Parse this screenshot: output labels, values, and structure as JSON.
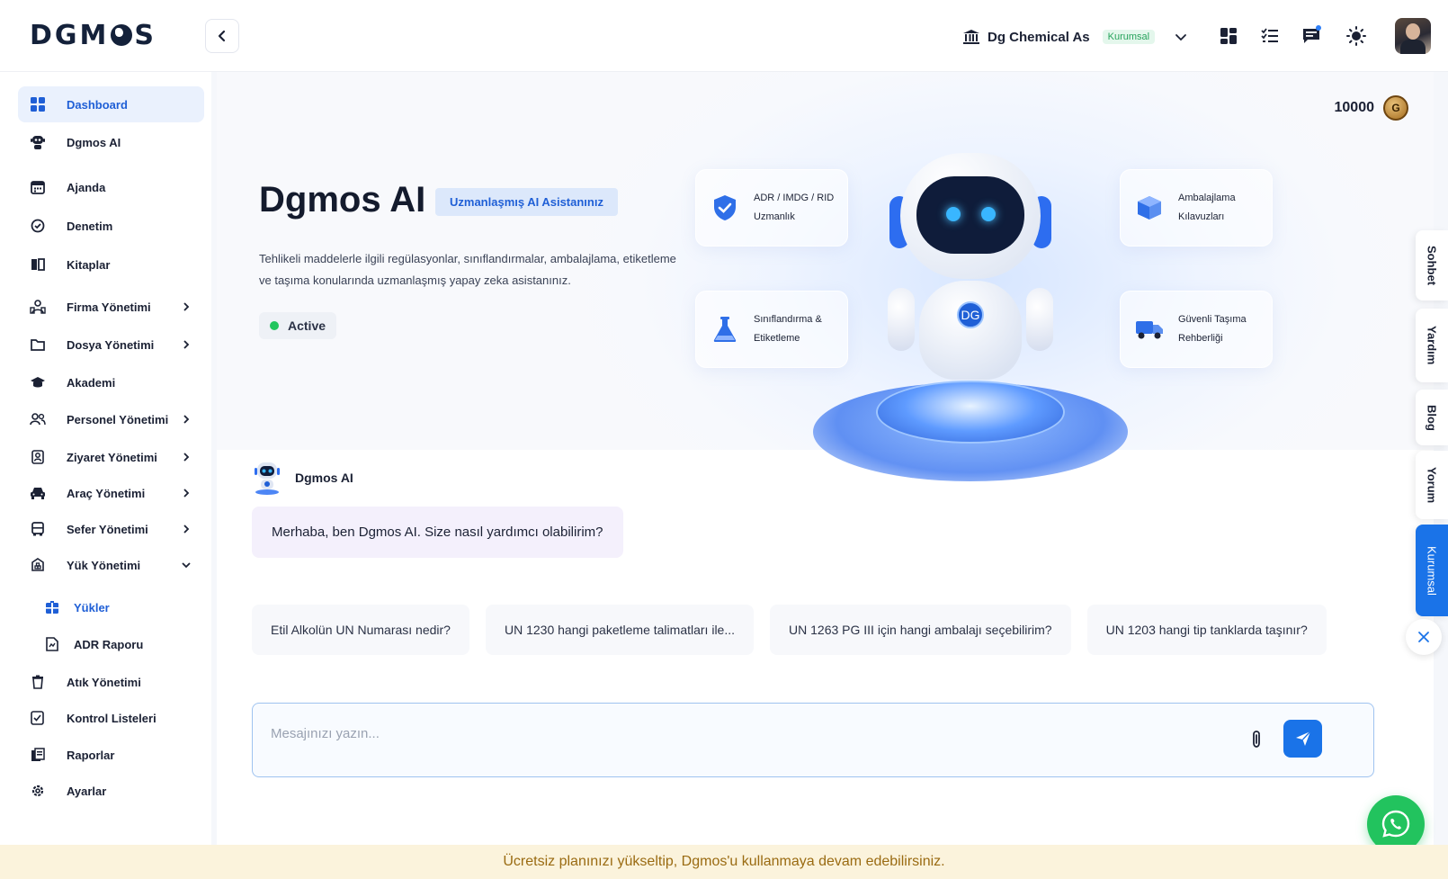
{
  "app": {
    "logo": "DGM",
    "logo_tail": "S"
  },
  "header": {
    "company_name": "Dg Chemical As",
    "company_badge": "Kurumsal"
  },
  "sidebar": {
    "items": [
      {
        "label": "Dashboard"
      },
      {
        "label": "Dgmos AI"
      },
      {
        "label": "Ajanda"
      },
      {
        "label": "Denetim"
      },
      {
        "label": "Kitaplar"
      },
      {
        "label": "Firma Yönetimi"
      },
      {
        "label": "Dosya Yönetimi"
      },
      {
        "label": "Akademi"
      },
      {
        "label": "Personel Yönetimi"
      },
      {
        "label": "Ziyaret Yönetimi"
      },
      {
        "label": "Araç Yönetimi"
      },
      {
        "label": "Sefer Yönetimi"
      },
      {
        "label": "Yük Yönetimi"
      },
      {
        "label": "Yükler"
      },
      {
        "label": "ADR Raporu"
      },
      {
        "label": "Atık Yönetimi"
      },
      {
        "label": "Kontrol Listeleri"
      },
      {
        "label": "Raporlar"
      },
      {
        "label": "Ayarlar"
      }
    ]
  },
  "hero": {
    "coins": "10000",
    "title": "Dgmos AI",
    "tag": "Uzmanlaşmış AI Asistanınız",
    "description": "Tehlikeli maddelerle ilgili regülasyonlar, sınıflandırmalar, ambalajlama, etiketleme ve taşıma konularında uzmanlaşmış yapay zeka asistanınız.",
    "status": "Active",
    "robot_badge": "DG",
    "features": [
      {
        "line1": "ADR / IMDG / RID",
        "line2": "Uzmanlık"
      },
      {
        "line1": "Ambalajlama",
        "line2": "Kılavuzları"
      },
      {
        "line1": "Sınıflandırma &",
        "line2": "Etiketleme"
      },
      {
        "line1": "Güvenli Taşıma",
        "line2": "Rehberliği"
      }
    ]
  },
  "chat": {
    "bot_name": "Dgmos AI",
    "greeting": "Merhaba, ben Dgmos AI. Size nasıl yardımcı olabilirim?",
    "suggestions": [
      "Etil Alkolün UN Numarası nedir?",
      "UN 1230 hangi paketleme talimatları ile...",
      "UN 1263 PG III için hangi ambalajı seçebilirim?",
      "UN 1203 hangi tip tanklarda taşınır?"
    ],
    "input_placeholder": "Mesajınızı yazın...",
    "input_value": ""
  },
  "right_tabs": [
    "Sohbet",
    "Yardım",
    "Blog",
    "Yorum",
    "Kurumsal"
  ],
  "banner": "Ücretsiz planınızı yükseltip, Dgmos'u kullanmaya devam edebilirsiniz.",
  "colors": {
    "accent": "#1a73e8",
    "active_bg": "#eaf1fd",
    "status_green": "#22c55e",
    "banner_bg": "#fbf3dc",
    "whatsapp": "#22c35e"
  }
}
